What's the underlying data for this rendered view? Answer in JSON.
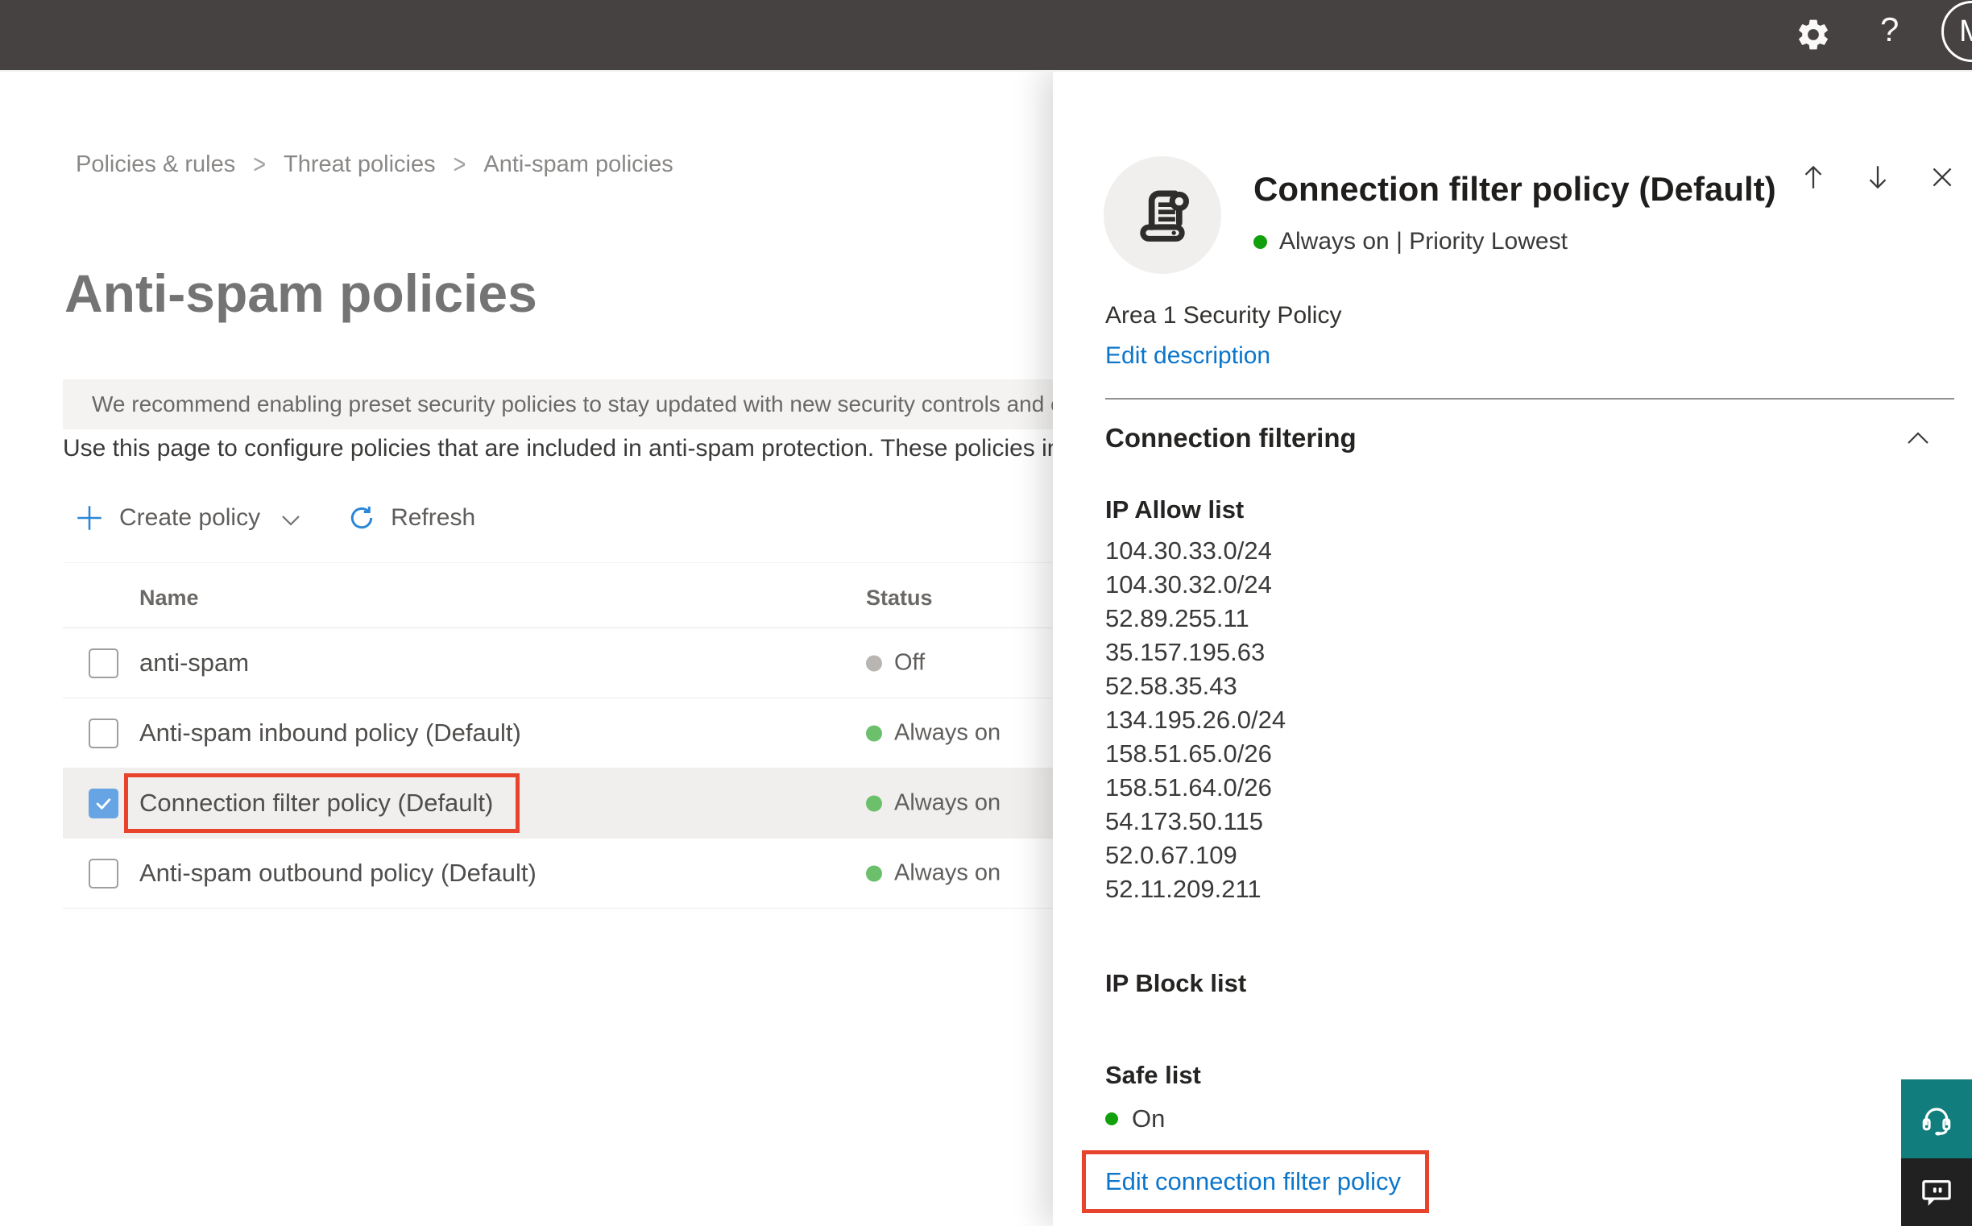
{
  "topbar": {
    "avatar_initial": "M"
  },
  "breadcrumb": {
    "items": [
      "Policies & rules",
      "Threat policies",
      "Anti-spam policies"
    ]
  },
  "main": {
    "title": "Anti-spam policies",
    "banner": "We recommend enabling preset security policies to stay updated with new security controls and our recommendations",
    "description": "Use this page to configure policies that are included in anti-spam protection. These policies include connection filtering"
  },
  "toolbar": {
    "create_label": "Create policy",
    "refresh_label": "Refresh"
  },
  "table": {
    "columns": {
      "name": "Name",
      "status": "Status"
    },
    "rows": [
      {
        "name": "anti-spam",
        "status": "Off"
      },
      {
        "name": "Anti-spam inbound policy (Default)",
        "status": "Always on"
      },
      {
        "name": "Connection filter policy (Default)",
        "status": "Always on"
      },
      {
        "name": "Anti-spam outbound policy (Default)",
        "status": "Always on"
      }
    ]
  },
  "panel": {
    "title": "Connection filter policy (Default)",
    "status": "Always on | Priority Lowest",
    "description": "Area 1 Security Policy",
    "edit_description": "Edit description",
    "section_title": "Connection filtering",
    "ip_allow_label": "IP Allow list",
    "ip_allow": [
      "104.30.33.0/24",
      "104.30.32.0/24",
      "52.89.255.11",
      "35.157.195.63",
      "52.58.35.43",
      "134.195.26.0/24",
      "158.51.65.0/26",
      "158.51.64.0/26",
      "54.173.50.115",
      "52.0.67.109",
      "52.11.209.211"
    ],
    "ip_block_label": "IP Block list",
    "safe_list_label": "Safe list",
    "safe_list_status": "On",
    "edit_link": "Edit connection filter policy"
  },
  "icons": {
    "topbar": [
      "settings-icon",
      "help-icon"
    ],
    "panel_nav": [
      "arrow-up-icon",
      "arrow-down-icon",
      "close-icon"
    ],
    "fabs": [
      "headset-icon",
      "chat-icon"
    ]
  },
  "colors": {
    "topbar_bg": "#454241",
    "accent_blue": "#0b76cc",
    "annotation_red": "#e8432d",
    "status_green_soft": "#6cc06c",
    "status_green_bright": "#12a10c",
    "status_gray": "#b8b5b2",
    "checkbox_blue": "#67a4e4",
    "teal_fab": "#117d7d",
    "dark_fab": "#212121"
  }
}
